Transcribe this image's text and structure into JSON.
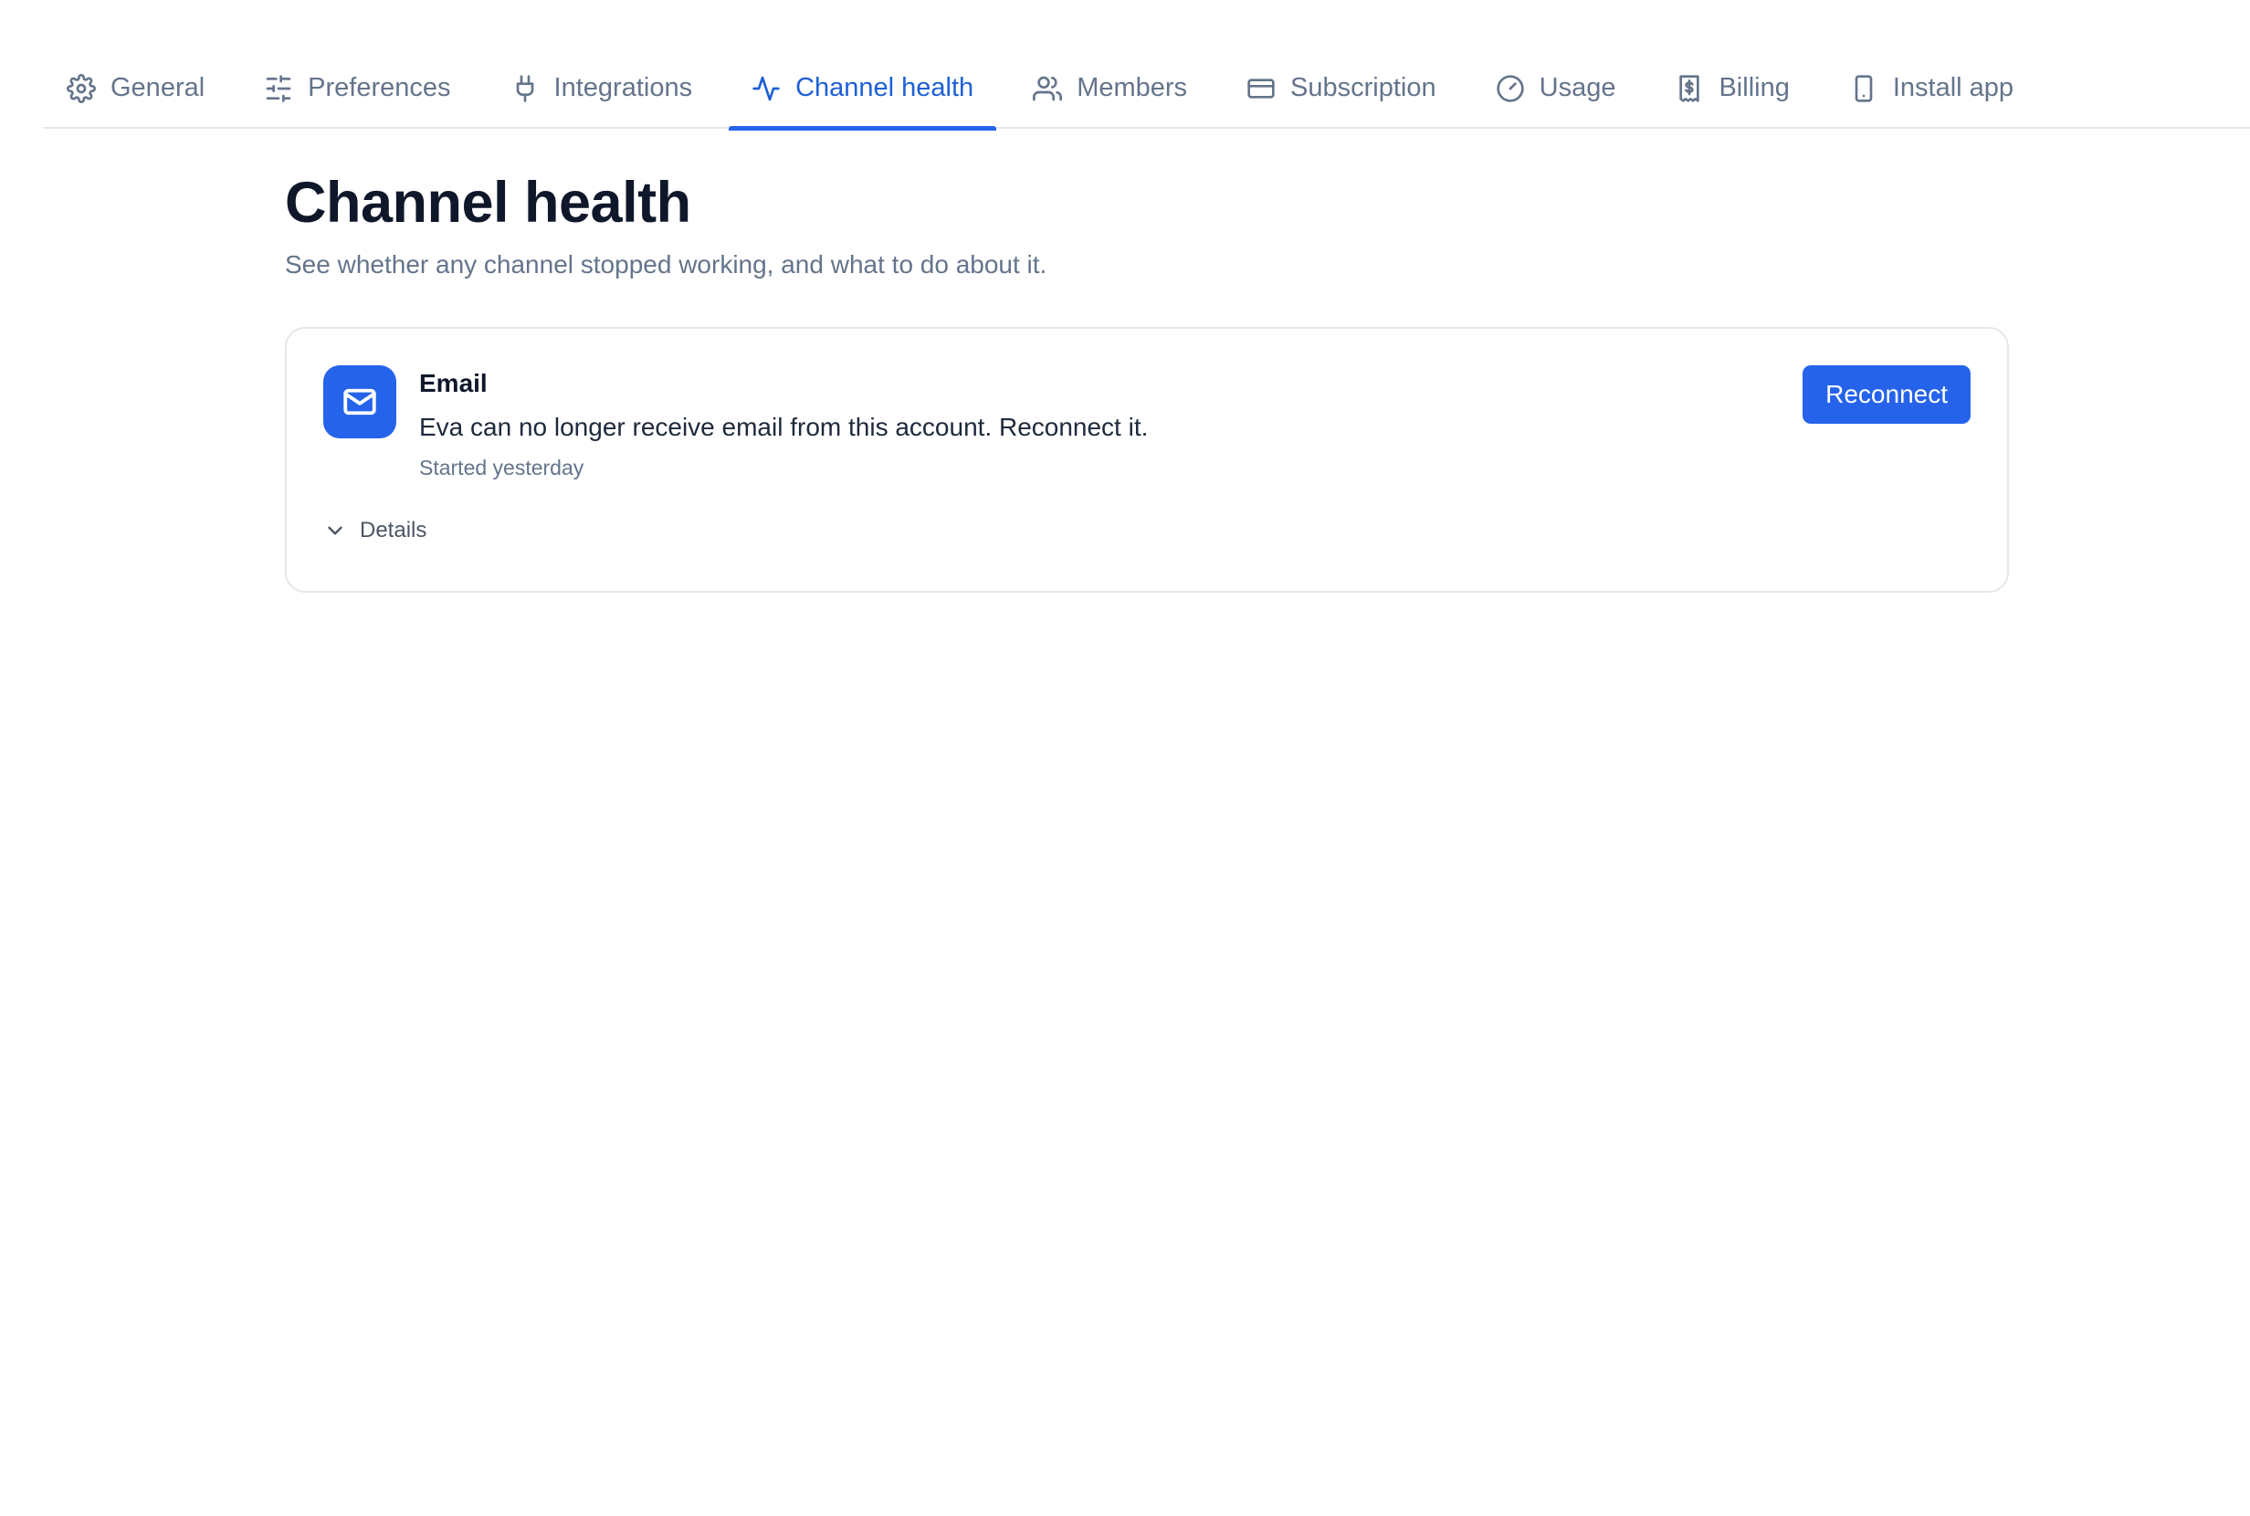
{
  "tabs": [
    {
      "label": "General",
      "icon": "gear-icon",
      "active": false
    },
    {
      "label": "Preferences",
      "icon": "sliders-icon",
      "active": false
    },
    {
      "label": "Integrations",
      "icon": "plug-icon",
      "active": false
    },
    {
      "label": "Channel health",
      "icon": "activity-icon",
      "active": true
    },
    {
      "label": "Members",
      "icon": "users-icon",
      "active": false
    },
    {
      "label": "Subscription",
      "icon": "credit-card-icon",
      "active": false
    },
    {
      "label": "Usage",
      "icon": "gauge-icon",
      "active": false
    },
    {
      "label": "Billing",
      "icon": "receipt-dollar-icon",
      "active": false
    },
    {
      "label": "Install app",
      "icon": "smartphone-icon",
      "active": false
    }
  ],
  "page": {
    "title": "Channel health",
    "subtitle": "See whether any channel stopped working, and what to do about it."
  },
  "channel": {
    "icon": "mail-icon",
    "name": "Email",
    "message": "Eva can no longer receive email from this account. Reconnect it.",
    "since": "Started yesterday",
    "action_label": "Reconnect",
    "details_label": "Details"
  },
  "colors": {
    "accent": "#2563eb",
    "active_tab_text": "#1d5fd6",
    "muted_text": "#64748b",
    "heading": "#0f172a",
    "border": "#e5e7eb"
  }
}
